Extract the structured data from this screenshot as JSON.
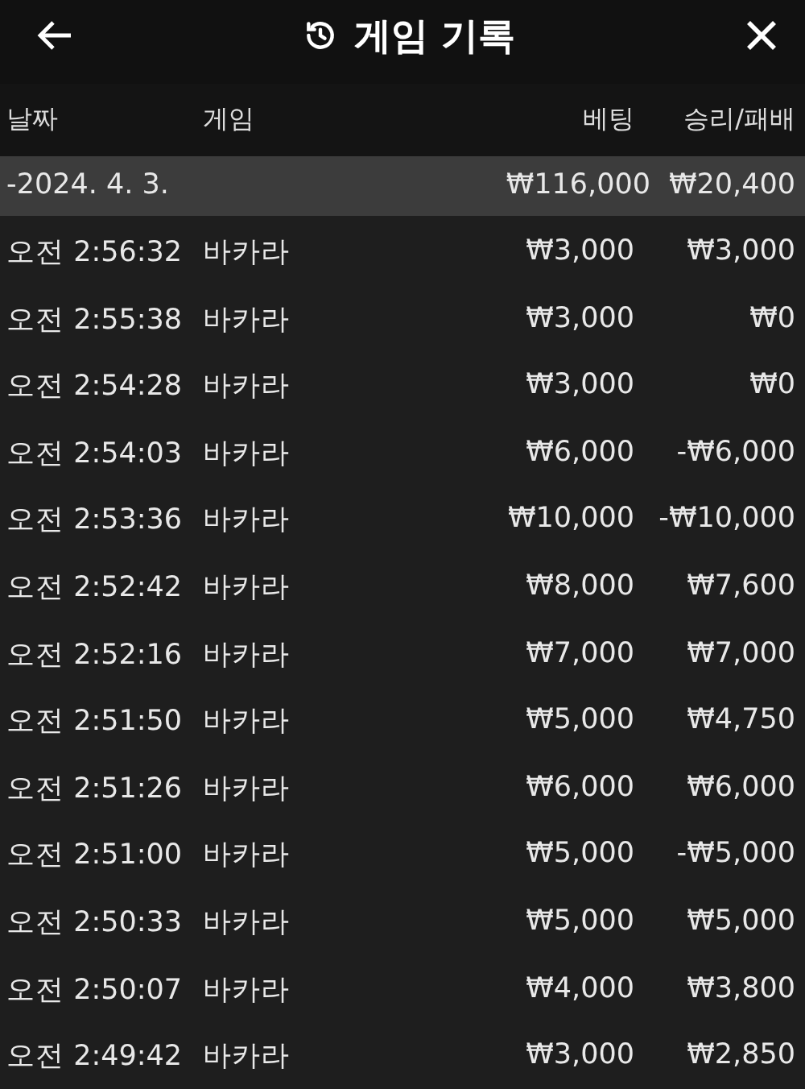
{
  "header": {
    "title": "게임 기록"
  },
  "columns": [
    "날짜",
    "게임",
    "베팅",
    "승리/패배"
  ],
  "day": {
    "date": "-2024. 4. 3.",
    "bet": "₩116,000",
    "result": "₩20,400"
  },
  "rows": [
    {
      "time": "오전 2:56:32",
      "game": "바카라",
      "bet": "₩3,000",
      "result": "₩3,000"
    },
    {
      "time": "오전 2:55:38",
      "game": "바카라",
      "bet": "₩3,000",
      "result": "₩0"
    },
    {
      "time": "오전 2:54:28",
      "game": "바카라",
      "bet": "₩3,000",
      "result": "₩0"
    },
    {
      "time": "오전 2:54:03",
      "game": "바카라",
      "bet": "₩6,000",
      "result": "-₩6,000"
    },
    {
      "time": "오전 2:53:36",
      "game": "바카라",
      "bet": "₩10,000",
      "result": "-₩10,000"
    },
    {
      "time": "오전 2:52:42",
      "game": "바카라",
      "bet": "₩8,000",
      "result": "₩7,600"
    },
    {
      "time": "오전 2:52:16",
      "game": "바카라",
      "bet": "₩7,000",
      "result": "₩7,000"
    },
    {
      "time": "오전 2:51:50",
      "game": "바카라",
      "bet": "₩5,000",
      "result": "₩4,750"
    },
    {
      "time": "오전 2:51:26",
      "game": "바카라",
      "bet": "₩6,000",
      "result": "₩6,000"
    },
    {
      "time": "오전 2:51:00",
      "game": "바카라",
      "bet": "₩5,000",
      "result": "-₩5,000"
    },
    {
      "time": "오전 2:50:33",
      "game": "바카라",
      "bet": "₩5,000",
      "result": "₩5,000"
    },
    {
      "time": "오전 2:50:07",
      "game": "바카라",
      "bet": "₩4,000",
      "result": "₩3,800"
    },
    {
      "time": "오전 2:49:42",
      "game": "바카라",
      "bet": "₩3,000",
      "result": "₩2,850"
    }
  ]
}
